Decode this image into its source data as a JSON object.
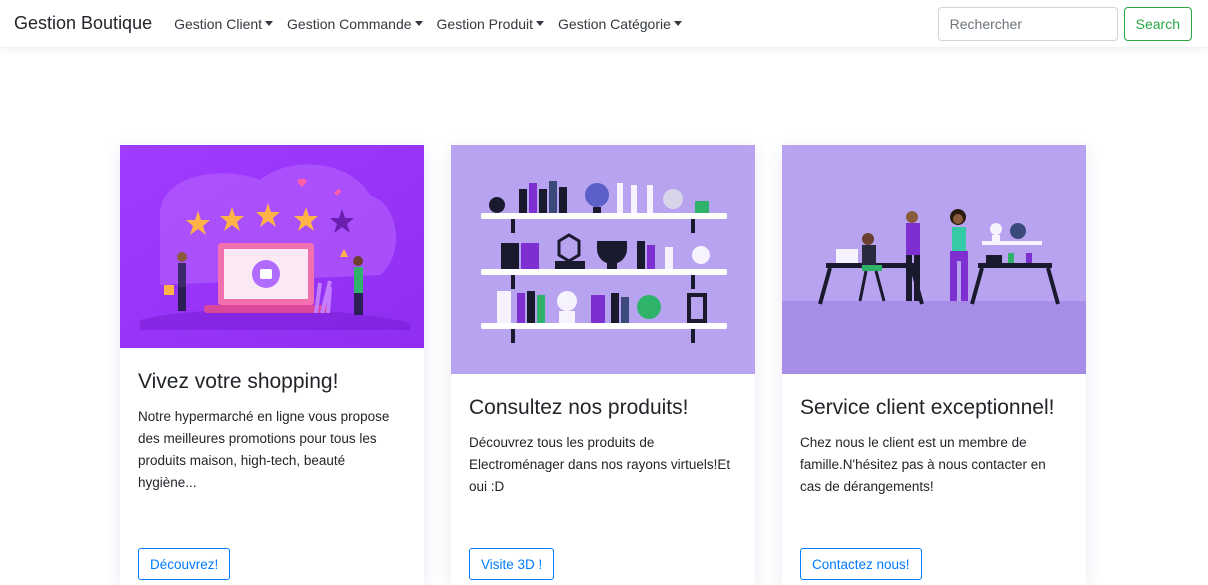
{
  "navbar": {
    "brand": "Gestion Boutique",
    "menu": [
      {
        "label": "Gestion Client"
      },
      {
        "label": "Gestion Commande"
      },
      {
        "label": "Gestion Produit"
      },
      {
        "label": "Gestion Catégorie"
      }
    ],
    "search": {
      "placeholder": "Rechercher",
      "button_label": "Search"
    }
  },
  "cards": [
    {
      "title": "Vivez votre shopping!",
      "text": "Notre hypermarché en ligne vous propose des meilleures promotions pour tous les produits maison, high-tech, beauté hygiène...",
      "button_label": "Découvrez!",
      "illustration": "rating-stars-laptop-illustration"
    },
    {
      "title": "Consultez nos produits!",
      "text": "Découvrez tous les produits de Electroménager dans nos rayons virtuels!Et oui :D",
      "button_label": "Visite 3D !",
      "illustration": "product-shelves-illustration"
    },
    {
      "title": "Service client exceptionnel!",
      "text": "Chez nous le client est un membre de famille.N'hésitez pas à nous contacter en cas de dérangements!",
      "button_label": "Contactez nous!",
      "illustration": "customer-service-team-illustration"
    }
  ],
  "colors": {
    "primary": "#007bff",
    "success": "#28a745",
    "purple": "#9b4dff",
    "lavender": "#b7a3f0"
  }
}
